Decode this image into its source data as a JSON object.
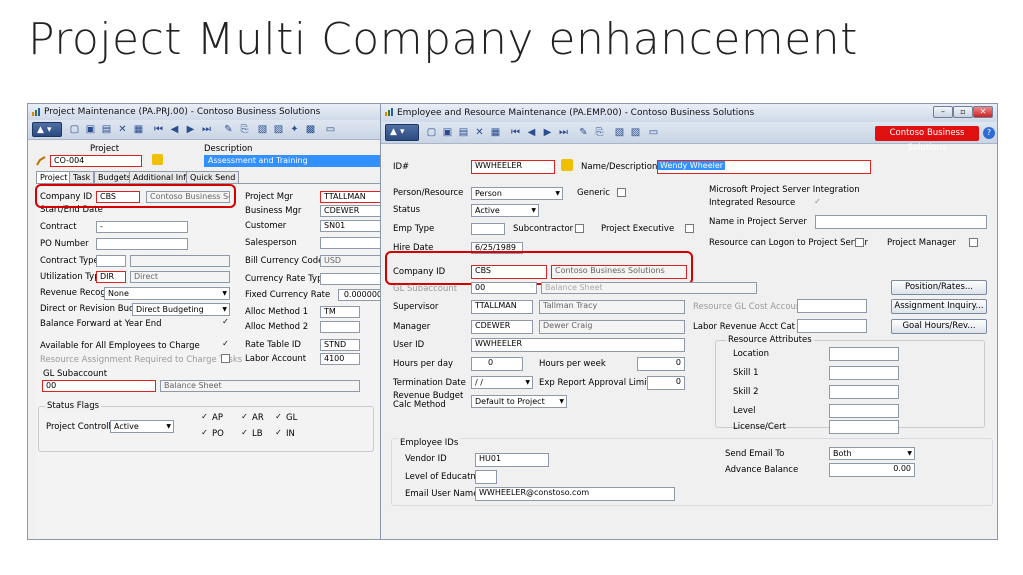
{
  "slide": {
    "title": "Project Multi Company enhancement"
  },
  "proj": {
    "title": "Project Maintenance (PA.PRJ.00) - Contoso Business Solutions",
    "lbl_project": "Project",
    "lbl_description": "Description",
    "project_id": "CO-004",
    "description": "Assessment and Training",
    "tabs": [
      "Project",
      "Task",
      "Budgets",
      "Additional Info",
      "Quick Send"
    ],
    "lbl_company_id": "Company ID",
    "company_id": "CBS",
    "company_name": "Contoso Business Soluti",
    "lbl_start_end": "Start/End Date",
    "lbl_contract": "Contract",
    "contract": "-",
    "lbl_po": "PO Number",
    "lbl_contract_type": "Contract Type",
    "lbl_util": "Utilization Type",
    "util_code": "DIR",
    "util_desc": "Direct",
    "lbl_rev_recog": "Revenue Recog Type",
    "rev_recog": "None",
    "lbl_direct_rev": "Direct or Revision Budget",
    "direct_rev": "Direct Budgeting",
    "lbl_balance_fwd": "Balance Forward at Year End",
    "lbl_avail": "Available for All Employees to Charge",
    "lbl_resource_req": "Resource Assignment Required to Charge Tasks",
    "lbl_proj_mgr": "Project Mgr",
    "proj_mgr": "TTALLMAN",
    "lbl_bus_mgr": "Business Mgr",
    "bus_mgr": "CDEWER",
    "lbl_customer": "Customer",
    "customer": "SN01",
    "lbl_salesperson": "Salesperson",
    "lbl_bill_cur": "Bill Currency Code",
    "bill_cur": "USD",
    "lbl_cur_rate_type": "Currency Rate Type",
    "lbl_fixed_rate": "Fixed Currency Rate",
    "fixed_rate": "0.000000",
    "lbl_alloc1": "Alloc Method 1",
    "alloc1": "TM",
    "lbl_alloc2": "Alloc Method 2",
    "lbl_rate_table": "Rate Table ID",
    "rate_table": "STND",
    "lbl_labor_acct": "Labor Account",
    "labor_acct": "4100",
    "lbl_gl_sub": "GL Subaccount",
    "gl_sub": "00",
    "gl_sub_desc": "Balance Sheet",
    "lbl_status_flags": "Status Flags",
    "lbl_proj_controller": "Project Controller:",
    "proj_controller": "Active",
    "flags": [
      "AP",
      "AR",
      "GL",
      "PO",
      "LB",
      "IN"
    ]
  },
  "emp": {
    "title": "Employee and Resource Maintenance (PA.EMP.00) - Contoso Business Solutions",
    "company_badge": "Contoso Business Solutions",
    "lbl_id": "ID#",
    "id": "WWHEELER",
    "lbl_name": "Name/Description",
    "name": "Wendy Wheeler",
    "lbl_person": "Person/Resource",
    "person": "Person",
    "lbl_generic": "Generic",
    "lbl_status": "Status",
    "status": "Active",
    "lbl_emp_type": "Emp Type",
    "lbl_subcontractor": "Subcontractor",
    "lbl_proj_exec": "Project Executive",
    "lbl_hire": "Hire Date",
    "hire": "6/25/1989",
    "lbl_company_id": "Company ID",
    "company_id": "CBS",
    "company_name": "Contoso Business Solutions",
    "lbl_gl_sub": "GL Subaccount",
    "gl_sub": "00",
    "gl_sub_desc": "Balance Sheet",
    "lbl_supervisor": "Supervisor",
    "supervisor": "TTALLMAN",
    "supervisor_name": "Tallman Tracy",
    "lbl_manager": "Manager",
    "manager": "CDEWER",
    "manager_name": "Dewer Craig",
    "lbl_user_id": "User ID",
    "user_id": "WWHEELER",
    "lbl_hours_day": "Hours per day",
    "hours_day": "0",
    "lbl_hours_week": "Hours per week",
    "hours_week": "0",
    "lbl_term": "Termination Date",
    "term": "/ /",
    "lbl_exp_limit": "Exp Report Approval Limit",
    "exp_limit": "0",
    "lbl_rev_budget": "Revenue Budget Calc Method",
    "rev_budget": "Default to Project",
    "lbl_mps": "Microsoft Project Server Integration",
    "lbl_integrated": "Integrated Resource",
    "lbl_name_in_server": "Name in Project Server",
    "lbl_logon": "Resource can Logon to Project Server",
    "lbl_proj_manager": "Project Manager",
    "btn_position": "Position/Rates...",
    "lbl_res_gl_cost": "Resource GL Cost Account",
    "btn_assignment": "Assignment Inquiry...",
    "lbl_labor_rev": "Labor Revenue Acct Cat",
    "btn_goal": "Goal Hours/Rev...",
    "lbl_res_attr": "Resource Attributes",
    "lbl_location": "Location",
    "lbl_skill1": "Skill 1",
    "lbl_skill2": "Skill 2",
    "lbl_level": "Level",
    "lbl_license": "License/Cert",
    "lbl_emp_ids": "Employee IDs",
    "lbl_vendor": "Vendor ID",
    "vendor": "HU01",
    "lbl_level_edu": "Level of Educatn",
    "lbl_email_user": "Email User Name",
    "email_user": "WWHEELER@constoso.com",
    "lbl_send_email": "Send Email To",
    "send_email": "Both",
    "lbl_advance": "Advance Balance",
    "advance": "0.00"
  }
}
